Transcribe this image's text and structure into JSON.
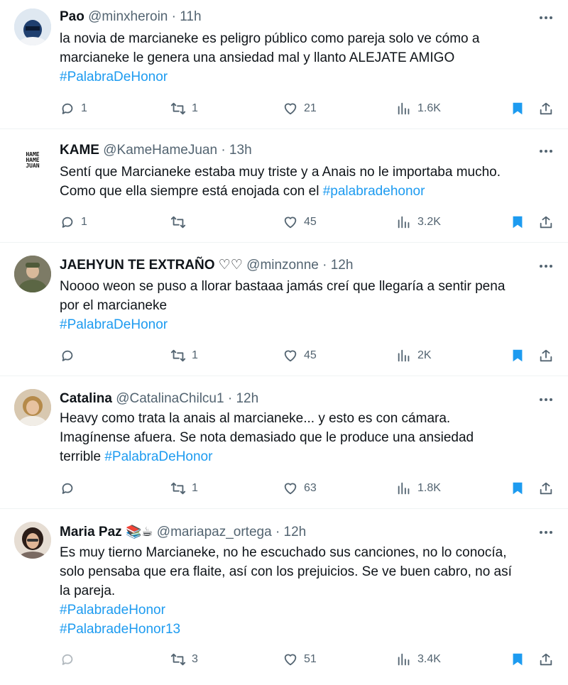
{
  "tweets": [
    {
      "name": "Pao",
      "handle": "@minxheroin",
      "time": "· 11h",
      "lines": [
        "la novia de marcianeke es peligro público como pareja solo ve cómo a",
        "marcianeke le genera una ansiedad mal y llanto ALEJATE AMIGO"
      ],
      "hashtags": [
        "#PalabraDeHonor"
      ],
      "replies": "1",
      "retweets": "1",
      "likes": "21",
      "views": "1.6K"
    },
    {
      "name": "KAME",
      "handle": "@KameHameJuan",
      "time": "· 13h",
      "lines": [
        "Sentí que Marcianeke estaba muy triste y a Anais no le importaba mucho.",
        "Como que ella siempre está enojada con el "
      ],
      "inline_tag": "#palabradehonor",
      "avatar_text": "HAME HAME JUAN",
      "replies": "1",
      "retweets": "",
      "likes": "45",
      "views": "3.2K"
    },
    {
      "name": "JAEHYUN TE EXTRAÑO ♡♡",
      "handle": "@minzonne",
      "time": "· 12h",
      "lines": [
        "Noooo weon se puso a llorar bastaaa jamás creí que llegaría a sentir pena",
        "por el marcianeke"
      ],
      "hashtags": [
        "#PalabraDeHonor"
      ],
      "replies": "",
      "retweets": "1",
      "likes": "45",
      "views": "2K"
    },
    {
      "name": "Catalina",
      "handle": "@CatalinaChilcu1",
      "time": "· 12h",
      "lines": [
        "Heavy como trata la anais al marcianeke... y esto es con cámara.",
        "Imagínense afuera. Se nota demasiado que le produce una ansiedad",
        "terrible "
      ],
      "inline_tag": "#PalabraDeHonor",
      "replies": "",
      "retweets": "1",
      "likes": "63",
      "views": "1.8K"
    },
    {
      "name": "Maria Paz",
      "emoji": "📚☕",
      "handle": "@mariapaz_ortega",
      "time": "· 12h",
      "lines": [
        "Es muy tierno Marcianeke, no he escuchado sus canciones, no lo conocía,",
        "solo pensaba que era flaite, así con los prejuicios. Se ve buen cabro, no así",
        "la pareja."
      ],
      "hashtags": [
        "#PalabradeHonor",
        "#PalabradeHonor13"
      ],
      "replies": "",
      "retweets": "3",
      "likes": "51",
      "views": "3.4K"
    }
  ],
  "colors": {
    "accent": "#1d9bf0",
    "bookmark": "#1d9bf0",
    "muted": "#536471"
  }
}
